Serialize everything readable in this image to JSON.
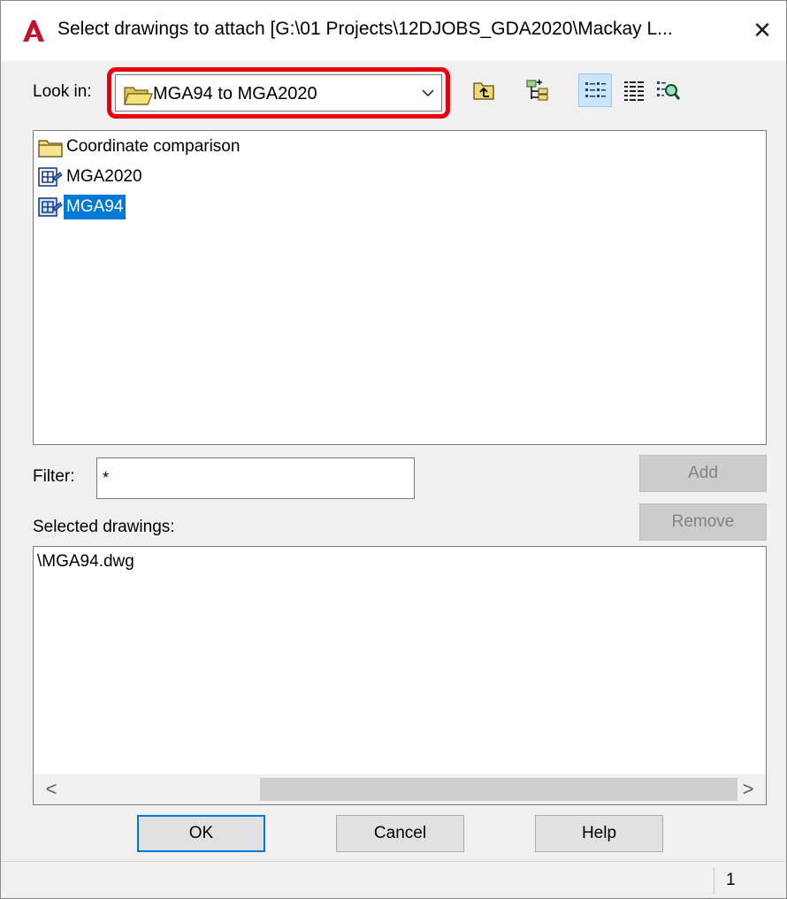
{
  "window": {
    "title": "Select drawings to attach [G:\\01 Projects\\12DJOBS_GDA2020\\Mackay L...",
    "close_glyph": "✕",
    "app_icon": "autocad-logo-icon"
  },
  "look_in": {
    "label": "Look in:",
    "value": "MGA94 to MGA2020",
    "icon": "open-folder-icon"
  },
  "toolbar": {
    "icons": [
      "up-folder-icon",
      "tree-view-icon",
      "list-view-icon",
      "details-view-icon",
      "preview-icon"
    ],
    "selected_view": "list-view-icon"
  },
  "files": [
    {
      "name": "Coordinate comparison",
      "icon": "folder-icon",
      "selected": false
    },
    {
      "name": "MGA2020",
      "icon": "drawing-set-icon",
      "selected": false
    },
    {
      "name": "MGA94",
      "icon": "drawing-set-icon",
      "selected": true
    }
  ],
  "filter": {
    "label": "Filter:",
    "value": "*"
  },
  "buttons": {
    "add": "Add",
    "remove": "Remove",
    "ok": "OK",
    "cancel": "Cancel",
    "help": "Help"
  },
  "selected_drawings": {
    "label": "Selected drawings:",
    "items": [
      "\\MGA94.dwg"
    ]
  },
  "scrollbar": {
    "left_arrow": "<",
    "right_arrow": ">"
  },
  "status": {
    "count": "1"
  },
  "colors": {
    "highlight": "#e8000b",
    "selection": "#0078d7"
  }
}
